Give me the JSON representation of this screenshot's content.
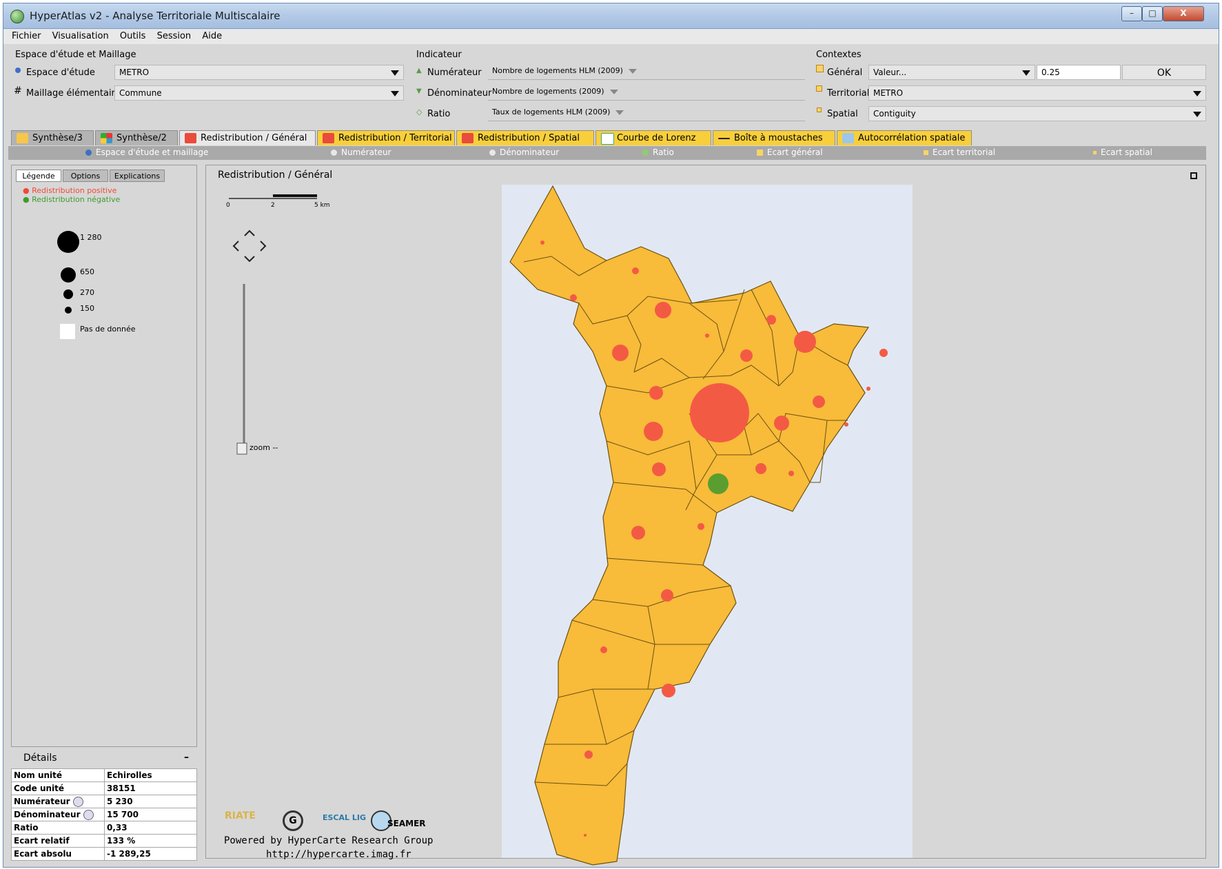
{
  "window": {
    "title": "HyperAtlas v2 - Analyse Territoriale Multiscalaire",
    "controls": [
      "–",
      "□",
      "X"
    ]
  },
  "menu": [
    "Fichier",
    "Visualisation",
    "Outils",
    "Session",
    "Aide"
  ],
  "study": {
    "section_title": "Espace d'étude et Maillage",
    "espace_label": "Espace d'étude",
    "espace_value": "METRO",
    "maillage_label": "Maillage élémentaire",
    "maillage_value": "Commune"
  },
  "indicator": {
    "section_title": "Indicateur",
    "numerateur_label": "Numérateur",
    "numerateur_value": "Nombre de logements HLM (2009)",
    "denominateur_label": "Dénominateur",
    "denominateur_value": "Nombre de logements (2009)",
    "ratio_label": "Ratio",
    "ratio_value": "Taux de logements HLM (2009)"
  },
  "contexts": {
    "section_title": "Contextes",
    "general_label": "Général",
    "general_value": "Valeur...",
    "general_number": "0.25",
    "ok_label": "OK",
    "territorial_label": "Territorial",
    "territorial_value": "METRO",
    "spatial_label": "Spatial",
    "spatial_value": "Contiguity"
  },
  "tabs": [
    {
      "label": "Synthèse/3",
      "active": false
    },
    {
      "label": "Synthèse/2",
      "active": false
    },
    {
      "label": "Redistribution / Général",
      "active": true
    },
    {
      "label": "Redistribution / Territorial",
      "active": false
    },
    {
      "label": "Redistribution / Spatial",
      "active": false
    },
    {
      "label": "Courbe de Lorenz",
      "active": false
    },
    {
      "label": "Boîte à moustaches",
      "active": false
    },
    {
      "label": "Autocorrélation spatiale",
      "active": false
    }
  ],
  "subtabs": [
    "Espace d'étude et maillage",
    "Numérateur",
    "Dénominateur",
    "Ratio",
    "Ecart général",
    "Ecart territorial",
    "Ecart spatial"
  ],
  "left_tabs": [
    "Légende",
    "Options",
    "Explications"
  ],
  "legend": {
    "positive": "Redistribution positive",
    "negative": "Redistribution négative",
    "sizes": [
      "1 280",
      "650",
      "270",
      "150"
    ],
    "no_data": "Pas de donnée"
  },
  "details": {
    "title": "Détails",
    "collapse": "–",
    "rows": [
      {
        "label": "Nom unité",
        "value": "Echirolles"
      },
      {
        "label": "Code unité",
        "value": "38151"
      },
      {
        "label": "Numérateur",
        "value": "5 230"
      },
      {
        "label": "Dénominateur",
        "value": "15 700"
      },
      {
        "label": "Ratio",
        "value": "0,33"
      },
      {
        "label": "Ecart relatif",
        "value": "133 %"
      },
      {
        "label": "Ecart absolu",
        "value": "-1 289,25"
      }
    ]
  },
  "map": {
    "title": "Redistribution / Général",
    "scale_labels": [
      "0",
      "2",
      "5 km"
    ],
    "zoom_label": "zoom --",
    "credits_line1": "Powered by HyperCarte Research Group",
    "credits_line2": "http://hypercarte.imag.fr",
    "logos": [
      "RIATE",
      "G",
      "ESCAL LIG",
      "SEAMER"
    ],
    "colors": {
      "fill": "#f8bb3a",
      "positive": "#f35a44",
      "negative": "#5a9e2f",
      "background": "#e1e8f3"
    }
  }
}
